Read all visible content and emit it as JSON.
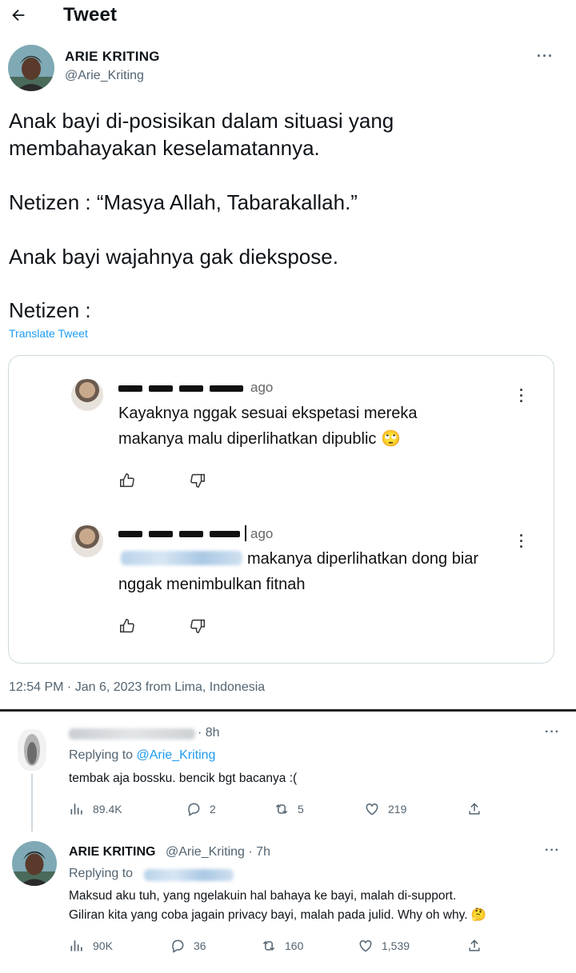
{
  "header": {
    "title": "Tweet"
  },
  "tweet": {
    "author_name": "ARIE KRITING",
    "author_handle": "@Arie_Kriting",
    "lines": [
      "Anak bayi di-posisikan dalam situasi yang",
      "membahayakan keselamatannya.",
      "Netizen : “Masya Allah, Tabarakallah.”",
      "Anak bayi wajahnya gak diekspose.",
      "Netizen :"
    ],
    "translate_label": "Translate Tweet",
    "timestamp": "12:54 PM · Jan 6, 2023 from Lima, Indonesia"
  },
  "embedded_comments": [
    {
      "time_suffix": "ago",
      "lines": [
        "Kayaknya nggak sesuai ekspetasi mereka",
        "makanya malu diperlihatkan dipublic 🙄"
      ]
    },
    {
      "time_suffix": "ago",
      "lines": [
        "makanya diperlihatkan dong biar",
        "nggak menimbulkan fitnah"
      ]
    }
  ],
  "replies": [
    {
      "time": "· 8h",
      "replying_prefix": "Replying to ",
      "replying_handle": "@Arie_Kriting",
      "text_lines": [
        "tembak aja bossku. bencik bgt bacanya :("
      ],
      "views": "89.4K",
      "replies": "2",
      "retweets": "5",
      "likes": "219"
    },
    {
      "name": "ARIE KRITING",
      "handle_time": "@Arie_Kriting · 7h",
      "replying_prefix": "Replying to",
      "text_lines": [
        "Maksud aku tuh, yang ngelakuin hal bahaya ke bayi, malah di-support.",
        "Giliran kita yang coba jagain privacy bayi, malah pada julid. Why oh why. 🤔"
      ],
      "views": "90K",
      "replies": "36",
      "retweets": "160",
      "likes": "1,539"
    }
  ],
  "colors": {
    "accent": "#1d9bf0",
    "secondary_text": "#536471",
    "border": "#cfd9de"
  },
  "icons": [
    "back-arrow-icon",
    "more-icon",
    "thumbs-up-icon",
    "thumbs-down-icon",
    "views-icon",
    "reply-icon",
    "retweet-icon",
    "like-icon",
    "share-icon"
  ]
}
